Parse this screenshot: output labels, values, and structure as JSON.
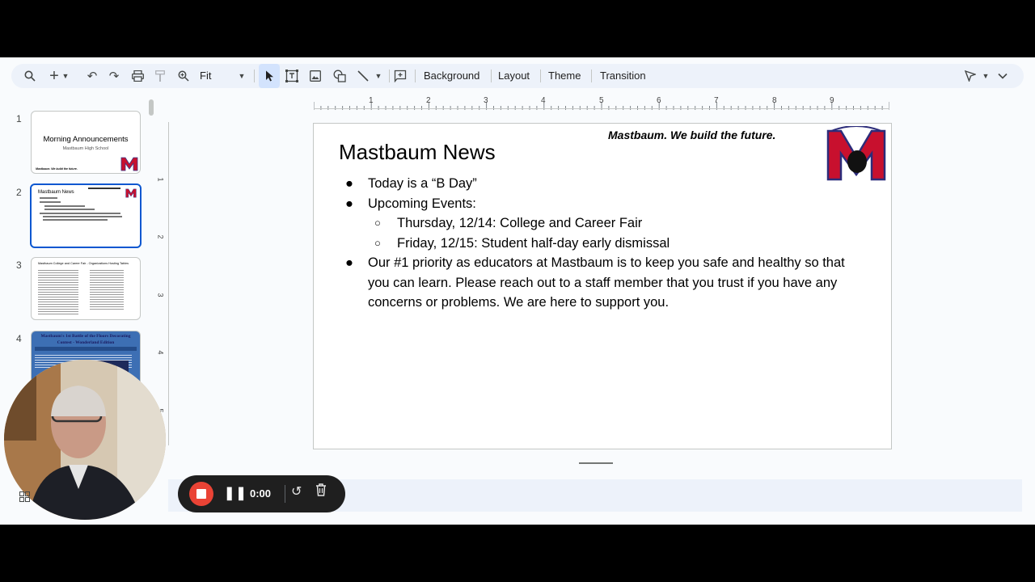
{
  "toolbar": {
    "zoom_value": "Fit",
    "background_label": "Background",
    "layout_label": "Layout",
    "theme_label": "Theme",
    "transition_label": "Transition"
  },
  "ruler": {
    "top_numbers": [
      "1",
      "2",
      "3",
      "4",
      "5",
      "6",
      "7",
      "8",
      "9"
    ],
    "left_numbers": [
      "1",
      "2",
      "3",
      "4",
      "5"
    ]
  },
  "filmstrip": {
    "slides": [
      {
        "number": "1",
        "title": "Morning Announcements",
        "subtitle": "Mastbaum High School",
        "footer": "Mastbaum. We build the future."
      },
      {
        "number": "2",
        "title": "Mastbaum News"
      },
      {
        "number": "3",
        "title": "Mastbaum College and Career Fair - Organizations Hosting Tables"
      },
      {
        "number": "4",
        "title": "Mastbaum's 1st Battle of the Floors Decorating Contest - Wonderland Edition"
      }
    ]
  },
  "slide": {
    "title": "Mastbaum News",
    "tagline": "Mastbaum.  We build the future.",
    "bullets": [
      {
        "level": 1,
        "text": "Today is a “B Day”"
      },
      {
        "level": 1,
        "text": "Upcoming Events:"
      },
      {
        "level": 2,
        "text": "Thursday, 12/14: College and Career Fair"
      },
      {
        "level": 2,
        "text": "Friday, 12/15: Student half-day early dismissal"
      },
      {
        "level": 1,
        "text": "Our #1 priority as educators at Mastbaum is to keep you safe and healthy so that you can learn.  Please reach out to a staff member that you trust if you have any concerns or problems.  We are here to support you."
      }
    ]
  },
  "recorder": {
    "time": "0:00"
  },
  "colors": {
    "accent": "#0b57d0",
    "record": "#ea4335",
    "logo_red": "#c8102e"
  }
}
